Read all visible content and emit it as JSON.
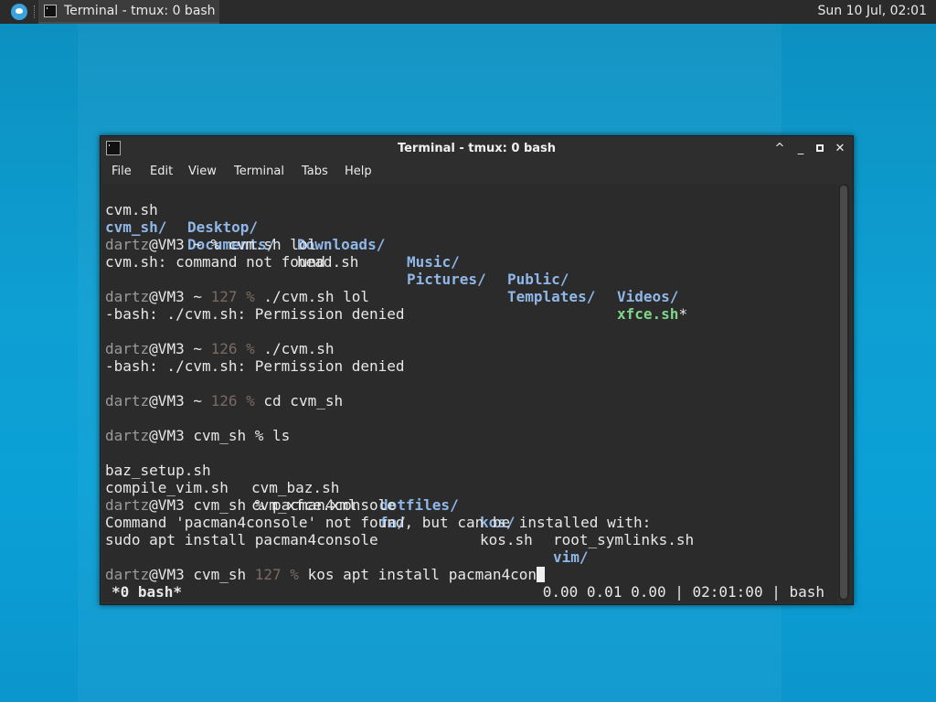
{
  "panel": {
    "taskbar_item": "Terminal - tmux: 0 bash",
    "clock": "Sun 10 Jul, 02:01"
  },
  "window": {
    "title": "Terminal - tmux: 0 bash",
    "menu": [
      "File",
      "Edit",
      "View",
      "Terminal",
      "Tabs",
      "Help"
    ]
  },
  "terminal": {
    "l1": {
      "a": "cvm.sh",
      "b": "Desktop/",
      "c": "Downloads/",
      "d": "Music/",
      "e": "Public/",
      "f": "Videos/"
    },
    "l2": {
      "a": "cvm_sh/",
      "b": "Documents/",
      "c": "head.sh",
      "d": "Pictures/",
      "e": "Templates/",
      "f": "xfce.sh",
      "g": "*"
    },
    "p1": {
      "user": "dartz",
      "host": "@VM3 ~ ",
      "code": "",
      "sym": "% ",
      "cmd": "cvm.sh lol"
    },
    "o1": "cvm.sh: command not found",
    "p2": {
      "user": "dartz",
      "host": "@VM3 ~ ",
      "code": "127 % ",
      "cmd": "./cvm.sh lol"
    },
    "o2": "-bash: ./cvm.sh: Permission denied",
    "p3": {
      "user": "dartz",
      "host": "@VM3 ~ ",
      "code": "126 % ",
      "cmd": "./cvm.sh"
    },
    "o3": "-bash: ./cvm.sh: Permission denied",
    "p4": {
      "user": "dartz",
      "host": "@VM3 ~ ",
      "code": "126 % ",
      "cmd": "cd cvm_sh"
    },
    "p5": {
      "user": "dartz",
      "host": "@VM3 cvm_sh ",
      "sym": "% ",
      "cmd": "ls"
    },
    "ls1": {
      "a": "baz_setup.sh",
      "b": "cvm_baz.sh",
      "c": "dotfiles/",
      "d": "kos/",
      "e": "root_symlinks.sh"
    },
    "ls2": {
      "a": "compile_vim.sh",
      "b": "cvm_xfce.xml",
      "c": "fa/",
      "d": "kos.sh",
      "e": "vim/"
    },
    "p6": {
      "user": "dartz",
      "host": "@VM3 cvm_sh ",
      "sym": "% ",
      "cmd": "pacman4console"
    },
    "o6a": "Command 'pacman4console' not found, but can be installed with:",
    "o6b": "sudo apt install pacman4console",
    "p7": {
      "user": "dartz",
      "host": "@VM3 cvm_sh ",
      "code": "127 % ",
      "cmd": "kos apt install pacman4con"
    },
    "status_left": "*0 bash*",
    "status_right": "0.00 0.01 0.00 | 02:01:00 | bash"
  },
  "colors": {
    "desktop": "#0e9fd3",
    "panel": "#2b2b2b",
    "terminal_bg": "#2b2b2b",
    "dir": "#8fb7e8",
    "exe": "#7fd58a"
  }
}
